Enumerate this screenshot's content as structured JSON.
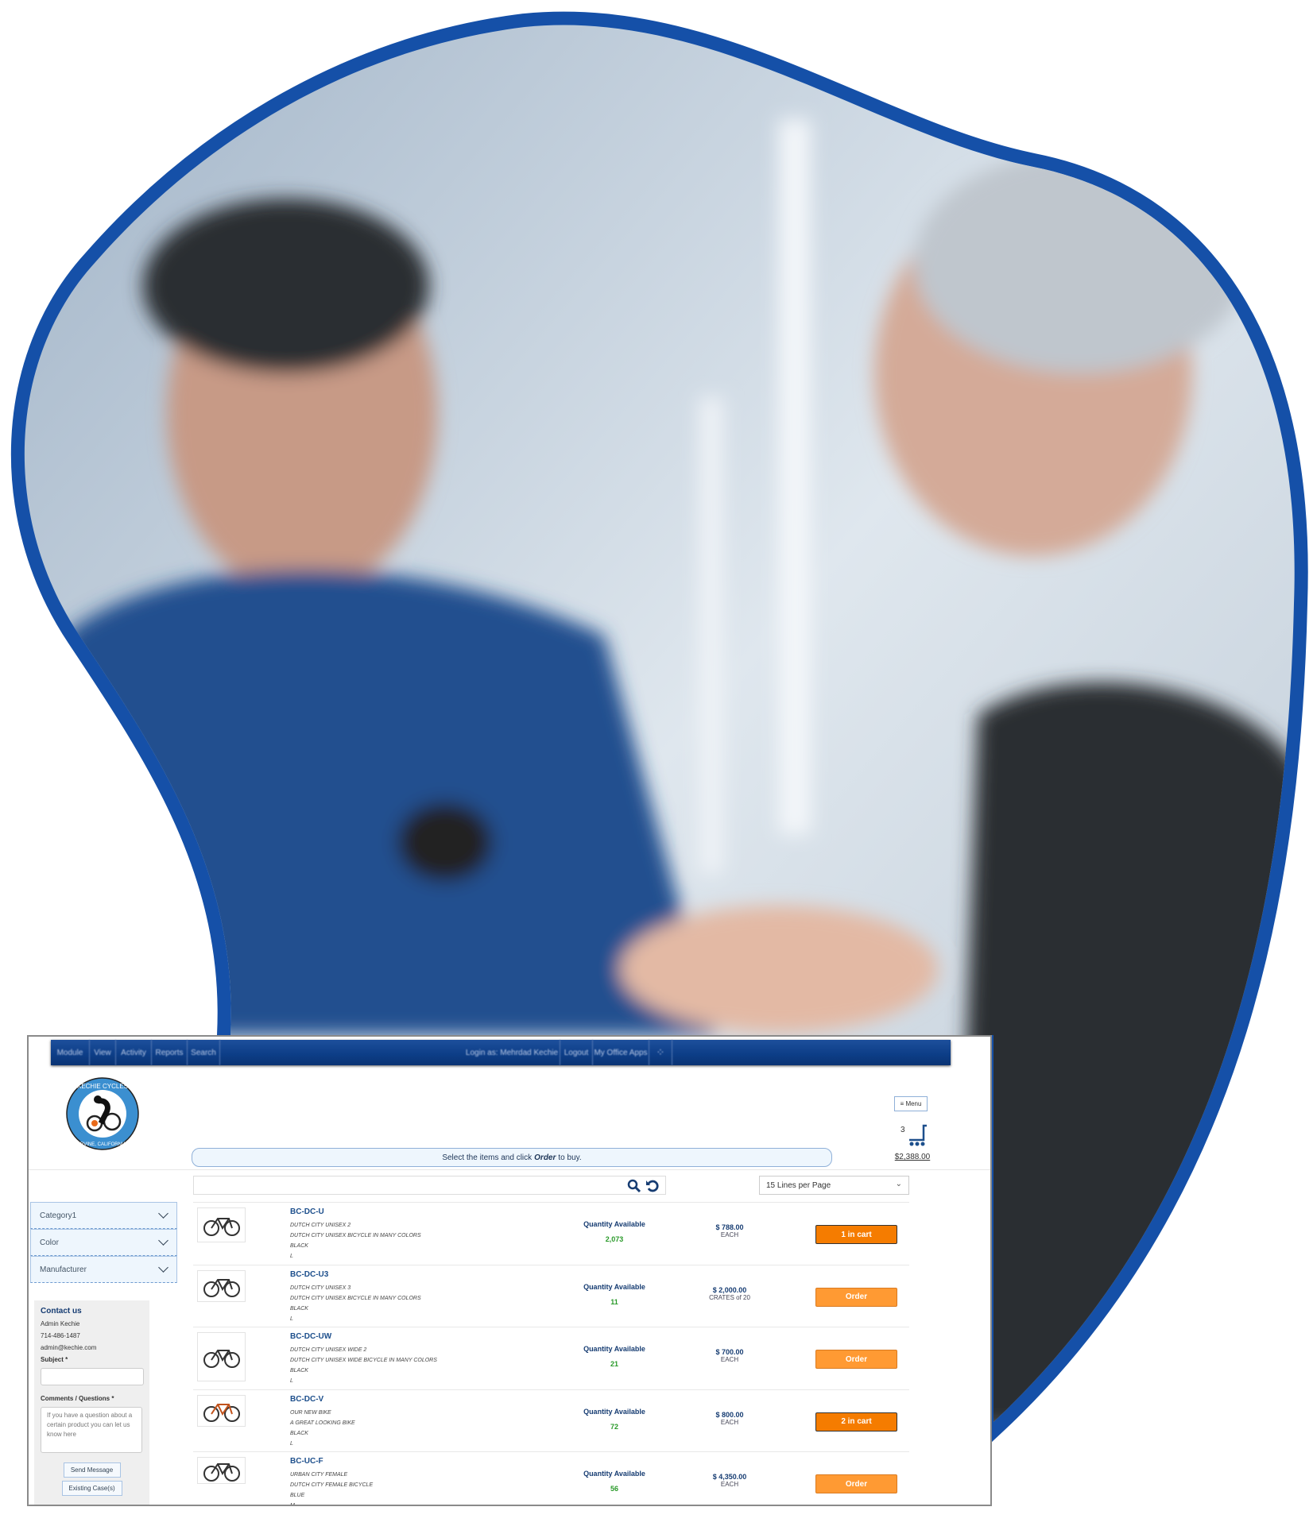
{
  "colors": {
    "brand_blue": "#1550a8",
    "nav_blue": "#0c3d86",
    "order_orange": "#ff9a33",
    "in_cart_orange": "#f57c00",
    "qty_green": "#2a9a2a"
  },
  "hero": {
    "description_icon": "photo-business-meeting"
  },
  "nav": {
    "items": [
      "Module",
      "View",
      "Activity",
      "Reports",
      "Search"
    ],
    "right_items": [
      "Login as: Mehrdad Kechie",
      "Logout",
      "My Office Apps"
    ],
    "apps_icon": "grid-icon"
  },
  "logo": {
    "text_top": "KECHIE CYCLES",
    "text_bottom": "IRVINE, CALIFORNIA"
  },
  "header": {
    "menu_label": "≡ Menu",
    "cart_count": "3",
    "cart_total": "$2,388.00",
    "banner_pre": "Select the items and click",
    "banner_bold": "Order",
    "banner_post": "to buy."
  },
  "toolbar": {
    "search_value": "",
    "lines_per_page": "15 Lines per Page"
  },
  "sidebar": {
    "filters": [
      "Category1",
      "Color",
      "Manufacturer"
    ],
    "contact": {
      "title": "Contact us",
      "name": "Admin Kechie",
      "phone": "714-486-1487",
      "email": "admin@kechie.com",
      "subject_label": "Subject *",
      "comments_label": "Comments / Questions *",
      "comments_placeholder": "If you have a question about a certain product you can let us know here",
      "send_label": "Send Message",
      "cases_label": "Existing Case(s)"
    }
  },
  "products": [
    {
      "sku": "BC-DC-U",
      "lines": [
        "DUTCH CITY UNISEX 2",
        "DUTCH CITY UNISEX BICYCLE IN MANY COLORS",
        "BLACK",
        "L"
      ],
      "qty_label": "Quantity Available",
      "qty": "2,073",
      "price": "$ 788.00",
      "unit": "EACH",
      "button": "1 in cart",
      "in_cart": true
    },
    {
      "sku": "BC-DC-U3",
      "lines": [
        "DUTCH CITY UNISEX 3",
        "DUTCH CITY UNISEX BICYCLE IN MANY COLORS",
        "BLACK",
        "L"
      ],
      "qty_label": "Quantity Available",
      "qty": "11",
      "price": "$ 2,000.00",
      "unit": "CRATES of 20",
      "button": "Order",
      "in_cart": false
    },
    {
      "sku": "BC-DC-UW",
      "lines": [
        "DUTCH CITY UNISEX WIDE 2",
        "DUTCH CITY UNISEX WIDE BICYCLE IN MANY COLORS",
        "BLACK",
        "L"
      ],
      "qty_label": "Quantity Available",
      "qty": "21",
      "price": "$ 700.00",
      "unit": "EACH",
      "button": "Order",
      "in_cart": false
    },
    {
      "sku": "BC-DC-V",
      "lines": [
        "OUR NEW BIKE",
        "A GREAT LOOKING BIKE",
        "BLACK",
        "L"
      ],
      "qty_label": "Quantity Available",
      "qty": "72",
      "price": "$ 800.00",
      "unit": "EACH",
      "button": "2 in cart",
      "in_cart": true
    },
    {
      "sku": "BC-UC-F",
      "lines": [
        "URBAN CITY FEMALE",
        "DUTCH CITY FEMALE BICYCLE",
        "BLUE",
        "M"
      ],
      "qty_label": "Quantity Available",
      "qty": "56",
      "price": "$ 4,350.00",
      "unit": "EACH",
      "button": "Order",
      "in_cart": false
    }
  ]
}
